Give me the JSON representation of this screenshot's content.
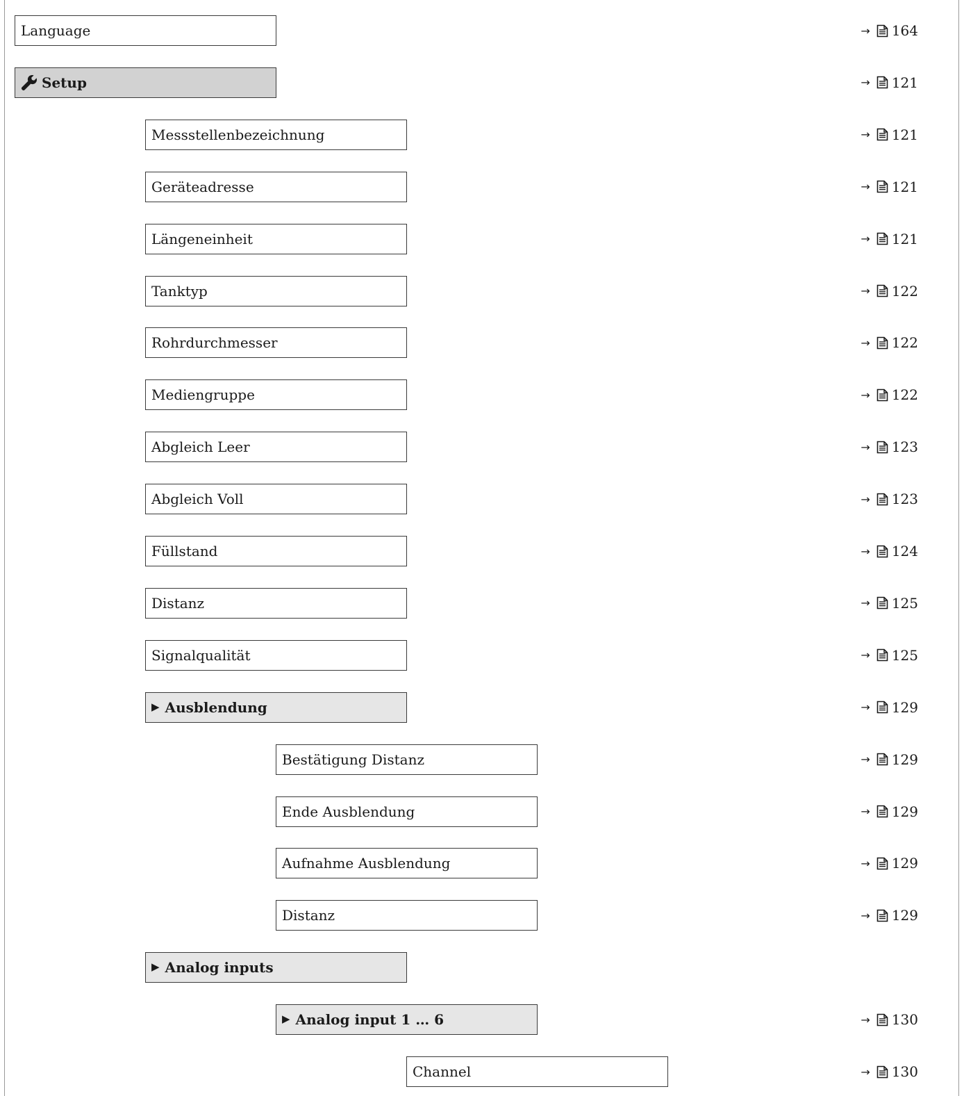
{
  "rows": [
    {
      "label": "Language",
      "type": "param",
      "level": 0,
      "ref": "164"
    },
    {
      "label": "Setup",
      "type": "menu",
      "level": 0,
      "ref": "121",
      "icon": "wrench-icon"
    },
    {
      "label": "Messstellenbezeichnung",
      "type": "param",
      "level": 1,
      "ref": "121"
    },
    {
      "label": "Geräteadresse",
      "type": "param",
      "level": 1,
      "ref": "121"
    },
    {
      "label": "Längeneinheit",
      "type": "param",
      "level": 1,
      "ref": "121"
    },
    {
      "label": "Tanktyp",
      "type": "param",
      "level": 1,
      "ref": "122"
    },
    {
      "label": "Rohrdurchmesser",
      "type": "param",
      "level": 1,
      "ref": "122"
    },
    {
      "label": "Mediengruppe",
      "type": "param",
      "level": 1,
      "ref": "122"
    },
    {
      "label": "Abgleich Leer",
      "type": "param",
      "level": 1,
      "ref": "123"
    },
    {
      "label": "Abgleich Voll",
      "type": "param",
      "level": 1,
      "ref": "123"
    },
    {
      "label": "Füllstand",
      "type": "param",
      "level": 1,
      "ref": "124"
    },
    {
      "label": "Distanz",
      "type": "param",
      "level": 1,
      "ref": "125"
    },
    {
      "label": "Signalqualität",
      "type": "param",
      "level": 1,
      "ref": "125"
    },
    {
      "label": "Ausblendung",
      "type": "submenu",
      "level": 1,
      "ref": "129"
    },
    {
      "label": "Bestätigung Distanz",
      "type": "param",
      "level": 2,
      "ref": "129"
    },
    {
      "label": "Ende Ausblendung",
      "type": "param",
      "level": 2,
      "ref": "129"
    },
    {
      "label": "Aufnahme Ausblendung",
      "type": "param",
      "level": 2,
      "ref": "129"
    },
    {
      "label": "Distanz",
      "type": "param",
      "level": 2,
      "ref": "129"
    },
    {
      "label": "Analog inputs",
      "type": "submenu",
      "level": 1,
      "ref": ""
    },
    {
      "label": "Analog input 1 … 6",
      "type": "submenu",
      "level": 2,
      "ref": "130"
    },
    {
      "label": "Channel",
      "type": "param",
      "level": 3,
      "ref": "130"
    }
  ],
  "symbols": {
    "submenu_marker": "▶",
    "ref_arrow": "→"
  }
}
